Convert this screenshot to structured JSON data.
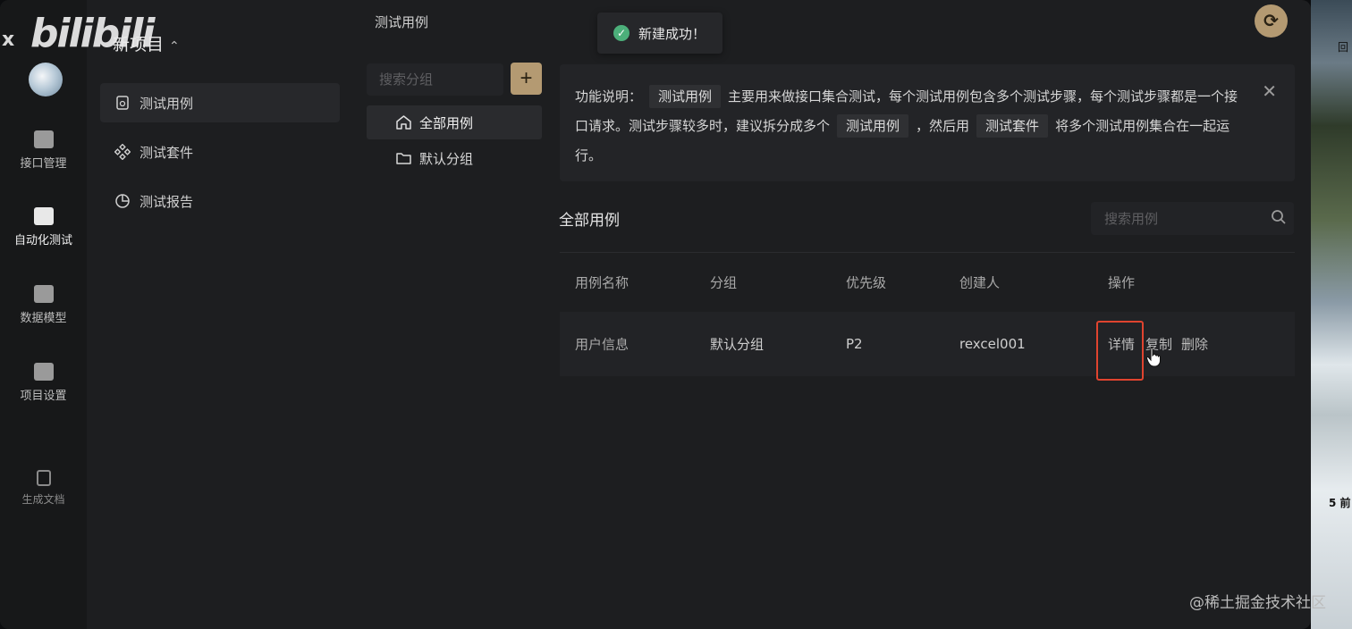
{
  "watermark": "bilibili",
  "window_close": "x",
  "rail": {
    "items": [
      {
        "label": "接口管理",
        "icon": "api-icon"
      },
      {
        "label": "自动化测试",
        "icon": "automation-icon"
      },
      {
        "label": "数据模型",
        "icon": "data-model-icon"
      },
      {
        "label": "项目设置",
        "icon": "project-settings-icon"
      },
      {
        "label": "生成文档",
        "icon": "document-icon"
      }
    ]
  },
  "project": {
    "title": "新项目",
    "switch_glyph": "⌃⌄"
  },
  "subnav": {
    "items": [
      {
        "label": "测试用例",
        "icon": "test-case-icon"
      },
      {
        "label": "测试套件",
        "icon": "test-suite-icon"
      },
      {
        "label": "测试报告",
        "icon": "report-pie-icon"
      }
    ]
  },
  "page_header": "测试用例",
  "toast": {
    "text": "新建成功！",
    "icon": "check-circle-icon"
  },
  "groups": {
    "search_placeholder": "搜索分组",
    "add_label": "+",
    "items": [
      {
        "label": "全部用例",
        "icon": "home-icon"
      },
      {
        "label": "默认分组",
        "icon": "folder-icon"
      }
    ]
  },
  "info": {
    "prefix": "功能说明：",
    "tag1": "测试用例",
    "text1": "主要用来做接口集合测试，每个测试用例包含多个测试步骤，每个测试步骤都是一个接口请求。测试步骤较多时，建议拆分成多个",
    "tag2": "测试用例",
    "text2": "，然后用",
    "tag3": "测试套件",
    "text3": "将多个测试用例集合在一起运行。",
    "close": "✕"
  },
  "cases": {
    "title": "全部用例",
    "search_placeholder": "搜索用例",
    "columns": [
      "用例名称",
      "分组",
      "优先级",
      "创建人",
      "操作"
    ],
    "rows": [
      {
        "name": "用户信息",
        "group": "默认分组",
        "priority": "P2",
        "creator": "rexcel001",
        "actions": [
          "详情",
          "复制",
          "删除"
        ]
      }
    ]
  },
  "refresh_icon": "⟳",
  "desktop": {
    "label_top": "回",
    "label_bottom": "5 前"
  },
  "footer_watermark": "@稀土掘金技术社区",
  "colors": {
    "accent": "#b49a72",
    "highlight": "#e0442f",
    "success": "#4caf7a"
  }
}
